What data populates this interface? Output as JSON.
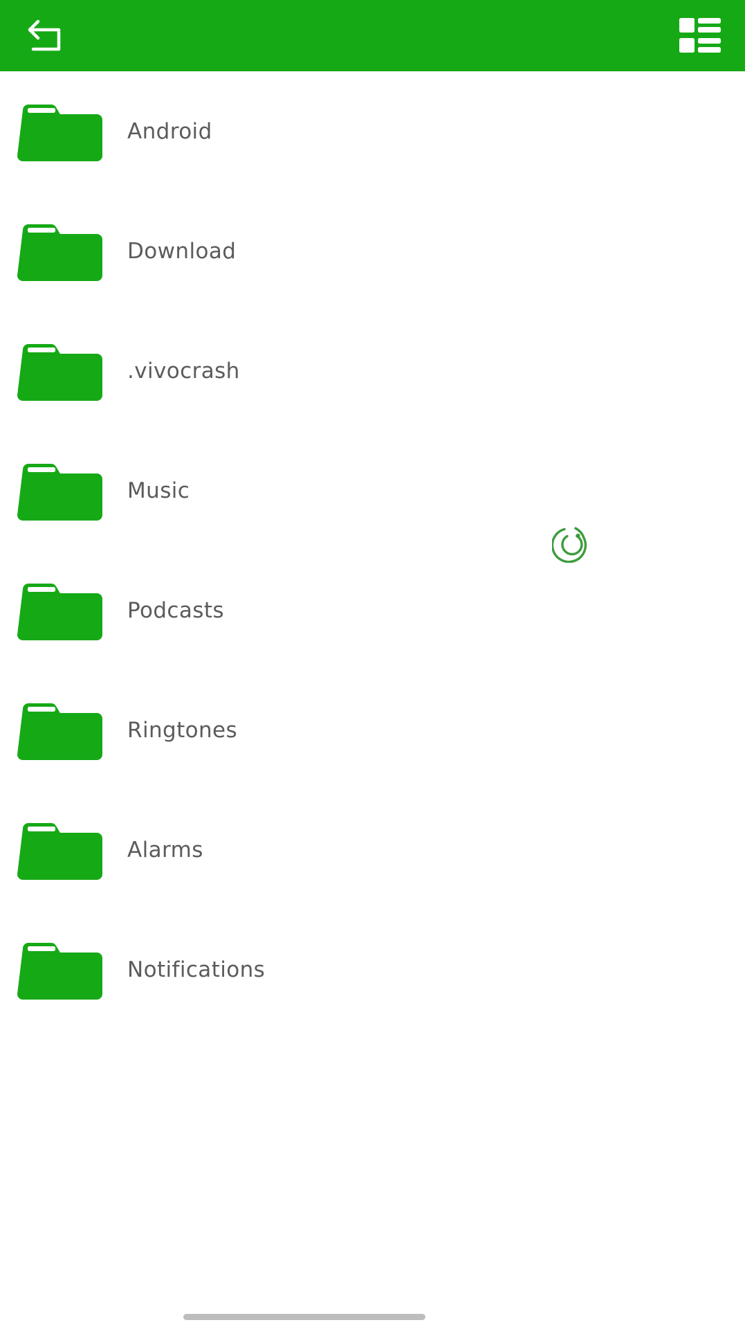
{
  "app": {
    "title": "File Manager",
    "accent_color": "#16a916",
    "background_color": "#ffffff",
    "label_color": "#5b5b5b"
  },
  "header": {
    "back_button": {
      "name": "back-icon",
      "label": "Back",
      "icon": "return-arrow-icon",
      "color": "#ffffff"
    },
    "view_toggle": {
      "name": "list-view-icon",
      "label": "Switch view",
      "icon": "list-detail-view-icon",
      "color": "#ffffff"
    }
  },
  "file_list": {
    "items": [
      {
        "name": "Android",
        "icon": "folder-icon",
        "type": "folder"
      },
      {
        "name": "Download",
        "icon": "folder-icon",
        "type": "folder"
      },
      {
        "name": ".vivocrash",
        "icon": "folder-icon",
        "type": "folder"
      },
      {
        "name": "Music",
        "icon": "folder-icon",
        "type": "folder"
      },
      {
        "name": "Podcasts",
        "icon": "folder-icon",
        "type": "folder"
      },
      {
        "name": "Ringtones",
        "icon": "folder-icon",
        "type": "folder"
      },
      {
        "name": "Alarms",
        "icon": "folder-icon",
        "type": "folder"
      },
      {
        "name": "Notifications",
        "icon": "folder-icon",
        "type": "folder"
      }
    ],
    "folder_color": "#16a916"
  },
  "overlay": {
    "spinner": {
      "name": "loading-spinner-icon",
      "label": "Loading",
      "color": "#3d9c3d"
    }
  },
  "system": {
    "gesture_bar": {
      "name": "home-gesture-bar",
      "color": "#bdbdbd"
    }
  }
}
